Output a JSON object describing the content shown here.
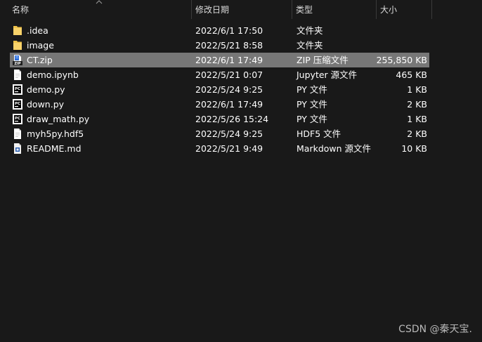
{
  "columns": {
    "name": "名称",
    "date": "修改日期",
    "type": "类型",
    "size": "大小"
  },
  "files": [
    {
      "name": ".idea",
      "date": "2022/6/1 17:50",
      "type": "文件夹",
      "size": "",
      "icon": "folder-icon",
      "selected": false
    },
    {
      "name": "image",
      "date": "2022/5/21 8:58",
      "type": "文件夹",
      "size": "",
      "icon": "folder-icon",
      "selected": false
    },
    {
      "name": "CT.zip",
      "date": "2022/6/1 17:49",
      "type": "ZIP 压缩文件",
      "size": "255,850 KB",
      "icon": "zip-icon",
      "selected": true
    },
    {
      "name": "demo.ipynb",
      "date": "2022/5/21 0:07",
      "type": "Jupyter 源文件",
      "size": "465 KB",
      "icon": "document-icon",
      "selected": false
    },
    {
      "name": "demo.py",
      "date": "2022/5/24 9:25",
      "type": "PY 文件",
      "size": "1 KB",
      "icon": "pycharm-icon",
      "selected": false
    },
    {
      "name": "down.py",
      "date": "2022/6/1 17:49",
      "type": "PY 文件",
      "size": "2 KB",
      "icon": "pycharm-icon",
      "selected": false
    },
    {
      "name": "draw_math.py",
      "date": "2022/5/26 15:24",
      "type": "PY 文件",
      "size": "1 KB",
      "icon": "pycharm-icon",
      "selected": false
    },
    {
      "name": "myh5py.hdf5",
      "date": "2022/5/24 9:25",
      "type": "HDF5 文件",
      "size": "2 KB",
      "icon": "document-icon",
      "selected": false
    },
    {
      "name": "README.md",
      "date": "2022/5/21 9:49",
      "type": "Markdown 源文件",
      "size": "10 KB",
      "icon": "markdown-icon",
      "selected": false
    }
  ],
  "watermark": "CSDN @秦天宝.",
  "colors": {
    "background": "#191919",
    "selected_row": "#777777",
    "folder": "#f0c24a"
  }
}
